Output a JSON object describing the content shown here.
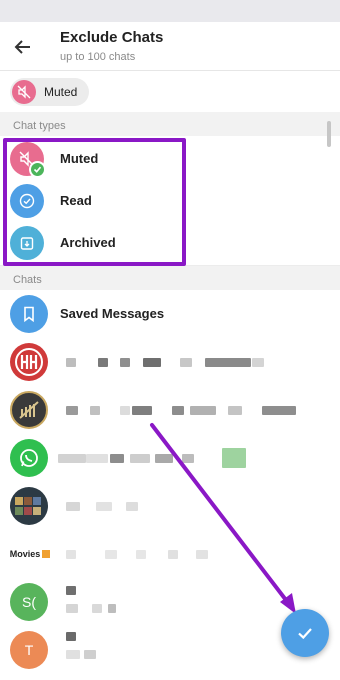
{
  "header": {
    "title": "Exclude Chats",
    "subtitle": "up to 100 chats"
  },
  "selected_chips": [
    {
      "label": "Muted",
      "icon": "muted-icon",
      "color": "#e86c8f"
    }
  ],
  "chat_types": {
    "section_title": "Chat types",
    "items": [
      {
        "label": "Muted",
        "icon": "muted-icon",
        "color": "#e86c8f",
        "selected": true
      },
      {
        "label": "Read",
        "icon": "read-icon",
        "color": "#4e9fe5",
        "selected": false
      },
      {
        "label": "Archived",
        "icon": "archived-icon",
        "color": "#4fb0d8",
        "selected": false
      }
    ]
  },
  "chats": {
    "section_title": "Chats",
    "items": [
      {
        "label": "Saved Messages",
        "icon": "bookmark-icon",
        "color": "#4e9fe5"
      },
      {
        "label": "",
        "avatar_text": "",
        "color": "#d03a3a"
      },
      {
        "label": "",
        "avatar_text": "",
        "color": "#3a3a3a"
      },
      {
        "label": "",
        "avatar_text": "",
        "color": "#2fbf4f"
      },
      {
        "label": "",
        "avatar_text": "",
        "color": "#2c3a44"
      },
      {
        "label": "",
        "avatar_text": "Movies",
        "color": "#ffffff"
      },
      {
        "label": "",
        "avatar_text": "S(",
        "color": "#58b45c"
      },
      {
        "label": "",
        "avatar_text": "T",
        "color": "#ec8a55"
      }
    ]
  },
  "fab": {
    "icon": "check-icon",
    "color": "#4e9fe5"
  },
  "annotation": {
    "box_color": "#8a18c6",
    "arrow_color": "#8a18c6"
  }
}
